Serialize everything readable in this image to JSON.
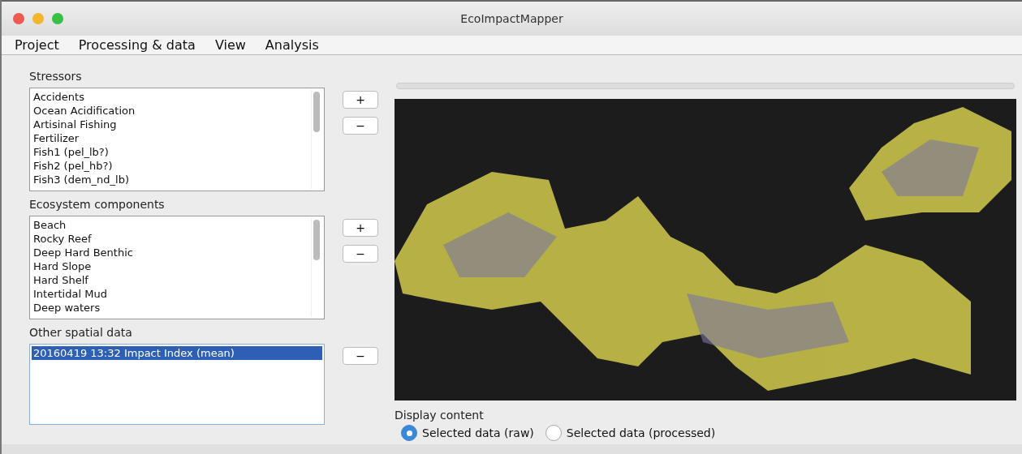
{
  "window": {
    "title": "EcoImpactMapper"
  },
  "menu": [
    "Project",
    "Processing & data",
    "View",
    "Analysis"
  ],
  "lists": [
    {
      "title": "Stressors",
      "items": [
        {
          "label": "Accidents",
          "selected": false
        },
        {
          "label": "Ocean Acidification",
          "selected": false
        },
        {
          "label": "Artisinal Fishing",
          "selected": false
        },
        {
          "label": "Fertilizer",
          "selected": false
        },
        {
          "label": "Fish1 (pel_lb?)",
          "selected": false
        },
        {
          "label": "Fish2 (pel_hb?)",
          "selected": false
        },
        {
          "label": "Fish3 (dem_nd_lb)",
          "selected": false
        }
      ],
      "buttons": [
        "+",
        "−"
      ],
      "scrollbar": true
    },
    {
      "title": "Ecosystem components",
      "items": [
        {
          "label": "Beach",
          "selected": false
        },
        {
          "label": "Rocky Reef",
          "selected": false
        },
        {
          "label": "Deep Hard Benthic",
          "selected": false
        },
        {
          "label": "Hard Slope",
          "selected": false
        },
        {
          "label": "Hard Shelf",
          "selected": false
        },
        {
          "label": "Intertidal Mud",
          "selected": false
        },
        {
          "label": "Deep waters",
          "selected": false
        }
      ],
      "buttons": [
        "+",
        "−"
      ],
      "scrollbar": true
    },
    {
      "title": "Other spatial data",
      "items": [
        {
          "label": "20160419 13:32 Impact Index (mean)",
          "selected": true
        }
      ],
      "buttons": [
        "−"
      ],
      "scrollbar": false
    }
  ],
  "progress": {
    "level": 0
  },
  "display": {
    "title": "Display content",
    "options": [
      {
        "label": "Selected data (raw)",
        "selected": true
      },
      {
        "label": "Selected data (processed)",
        "selected": false
      }
    ]
  }
}
